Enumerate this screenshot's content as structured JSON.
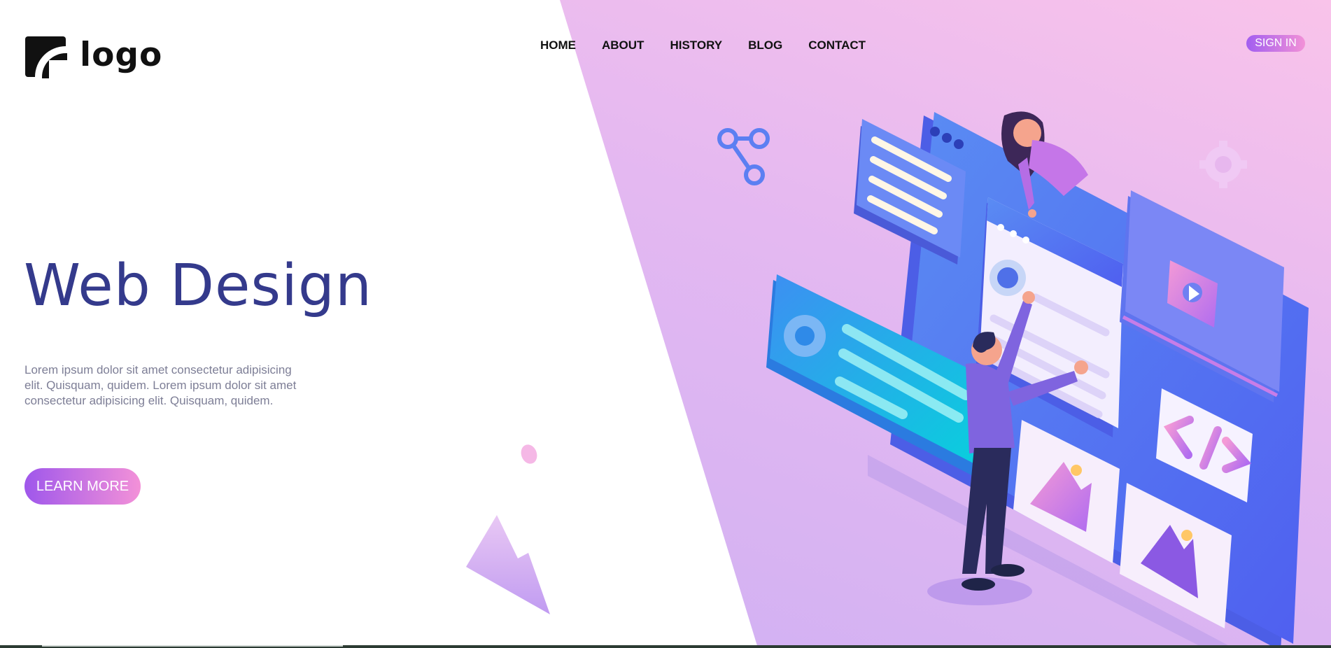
{
  "header": {
    "logo_text": "logo",
    "logo_icon": "wifi-arcs-icon",
    "nav": [
      "HOME",
      "ABOUT",
      "HISTORY",
      "BLOG",
      "CONTACT"
    ],
    "sign_in_label": "SIGN IN"
  },
  "hero": {
    "title": "Web Design",
    "description": "Lorem ipsum dolor sit amet consectetur adipisicing elit. Quisquam, quidem. Lorem ipsum dolor sit amet consectetur adipisicing elit. Quisquam, quidem.",
    "cta_label": "LEARN MORE"
  },
  "colors": {
    "title": "#343a8c",
    "body_text": "#7d7e96",
    "accent_start": "#9f57eb",
    "accent_end": "#f391d8",
    "background_pink": "#f9c3ea",
    "background_lilac": "#c9aef4"
  },
  "illustration": {
    "icons": [
      "share-icon",
      "gear-icon",
      "code-icon",
      "image-icon",
      "play-icon",
      "mountain-icon"
    ]
  }
}
